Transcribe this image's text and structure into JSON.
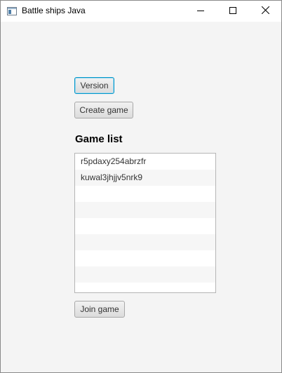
{
  "window": {
    "title": "Battle ships Java"
  },
  "buttons": {
    "version_label": "Version",
    "create_label": "Create game",
    "join_label": "Join game"
  },
  "game_list": {
    "heading": "Game list",
    "items": [
      "r5pdaxy254abrzfr",
      "kuwal3jhjjv5nrk9",
      "",
      "",
      "",
      "",
      "",
      "",
      ""
    ]
  },
  "icons": {
    "app": "window-app-icon",
    "minimize": "minimize-icon",
    "maximize": "maximize-icon",
    "close": "close-icon"
  },
  "colors": {
    "focus_border": "#0096c9",
    "background": "#f4f4f4"
  }
}
